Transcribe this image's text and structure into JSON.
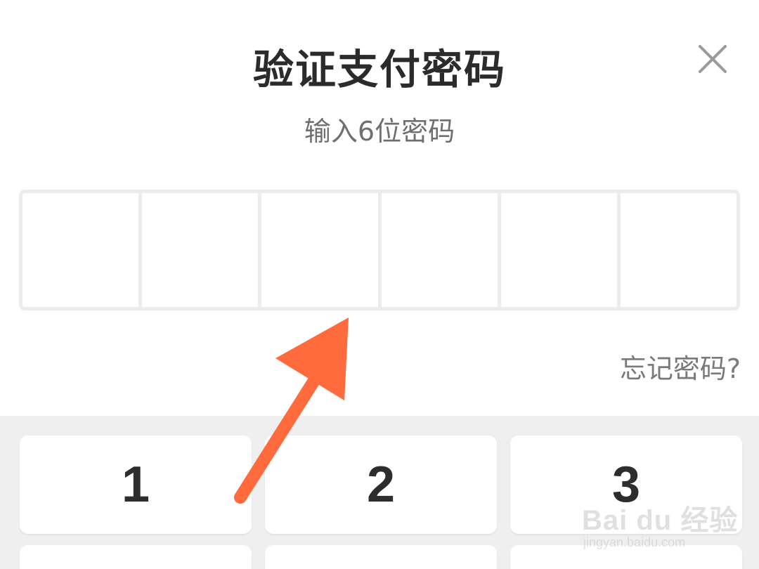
{
  "dialog": {
    "title": "验证支付密码",
    "subtitle": "输入6位密码",
    "forgot_label": "忘记密码?",
    "pin_length": 6
  },
  "keypad": {
    "keys": [
      "1",
      "2",
      "3"
    ]
  },
  "annotation": {
    "arrow_color": "#ff6b3d"
  },
  "watermark": {
    "logo_text": "Bai du 经验",
    "url": "jingyan.baidu.com"
  },
  "icons": {
    "close": "close-icon"
  }
}
